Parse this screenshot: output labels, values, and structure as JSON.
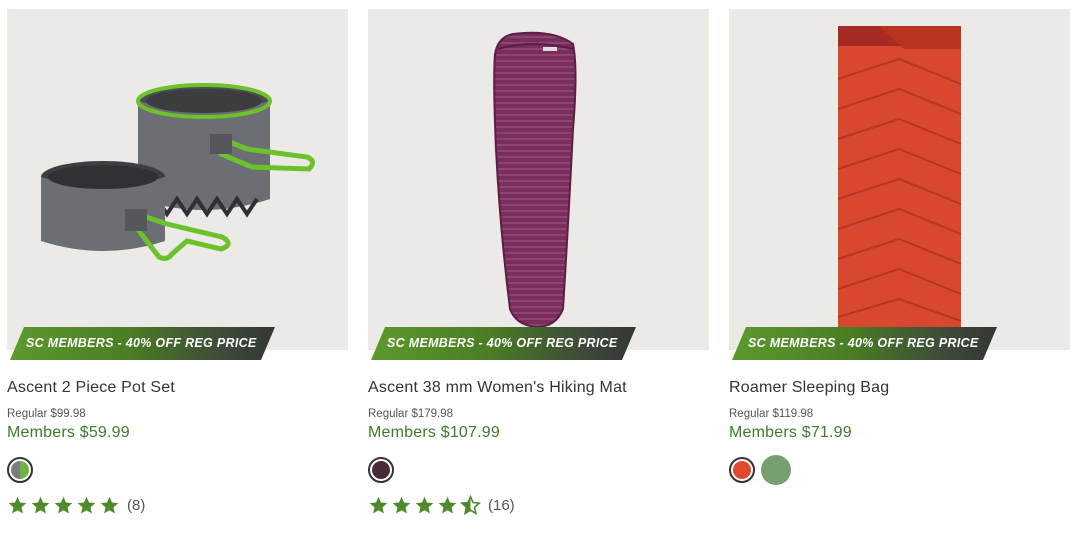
{
  "products": [
    {
      "image_alt": "Ascent 2 Piece Pot Set",
      "promo": "SC MEMBERS - 40% OFF REG PRICE",
      "title": "Ascent 2 Piece Pot Set",
      "regular": "Regular  $99.98",
      "members": "Members $59.99",
      "swatches": [
        {
          "name": "grey-green",
          "colors": [
            "#7a7d80",
            "#6db33f"
          ],
          "selected": true
        }
      ],
      "rating": 4.8,
      "review_count": "(8)"
    },
    {
      "image_alt": "Ascent 38 mm Women's Hiking Mat",
      "promo": "SC MEMBERS - 40% OFF REG PRICE",
      "title": "Ascent 38 mm Women's Hiking Mat",
      "regular": "Regular  $179.98",
      "members": "Members $107.99",
      "swatches": [
        {
          "name": "plum",
          "colors": [
            "#4a2a38"
          ],
          "selected": true
        }
      ],
      "rating": 4.5,
      "review_count": "(16)"
    },
    {
      "image_alt": "Roamer Sleeping Bag",
      "promo": "SC MEMBERS - 40% OFF REG PRICE",
      "title": "Roamer Sleeping Bag",
      "regular": "Regular  $119.98",
      "members": "Members $71.99",
      "swatches": [
        {
          "name": "red",
          "colors": [
            "#e0492f"
          ],
          "selected": true
        },
        {
          "name": "sage-green",
          "colors": [
            "#77a06e"
          ],
          "selected": false
        }
      ],
      "rating": null,
      "review_count": null
    }
  ],
  "colors": {
    "accent_green": "#3f7b2a",
    "star_green": "#4f8a2b",
    "card_bg": "#eceae6"
  }
}
